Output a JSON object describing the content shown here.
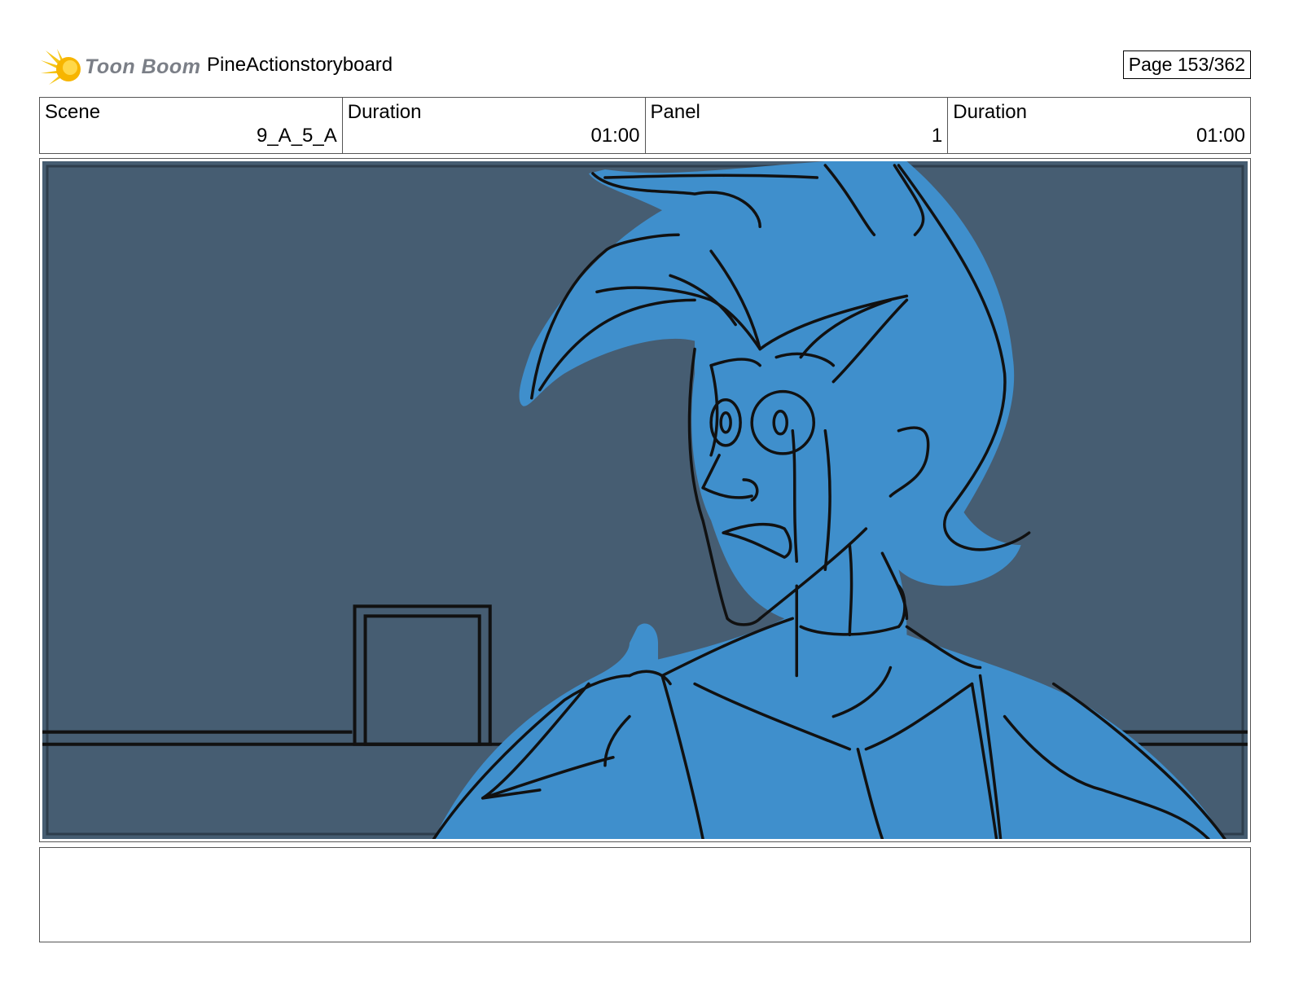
{
  "header": {
    "logo_text": "Toon Boom",
    "project_title": "PineActionstoryboard",
    "page_label": "Page 153/362"
  },
  "info": {
    "scene_label": "Scene",
    "scene_value": "9_A_5_A",
    "scene_duration_label": "Duration",
    "scene_duration_value": "01:00",
    "panel_label": "Panel",
    "panel_value": "1",
    "panel_duration_label": "Duration",
    "panel_duration_value": "01:00"
  },
  "panel": {
    "background_color": "#465d72",
    "character_color": "#3f8fcc",
    "line_color": "#111111"
  },
  "notes": {
    "text": ""
  }
}
